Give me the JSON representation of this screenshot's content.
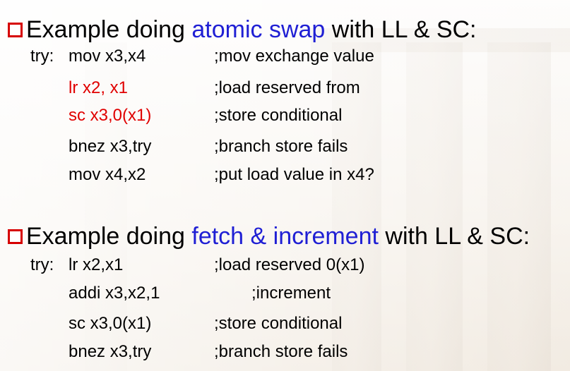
{
  "section1": {
    "heading_pre": "Example doing ",
    "heading_highlight": "atomic swap",
    "heading_post": " with LL & SC:",
    "label": "try:",
    "lines": [
      {
        "instr": "mov x3,x4",
        "comment": ";mov exchange value"
      },
      {
        "instr": "lr x2, x1",
        "comment": ";load reserved from"
      },
      {
        "instr": "sc x3,0(x1)",
        "comment": ";store conditional"
      },
      {
        "instr": "bnez x3,try",
        "comment": ";branch store fails"
      },
      {
        "instr": "mov x4,x2",
        "comment": ";put load value in x4?"
      }
    ]
  },
  "section2": {
    "heading_pre": "Example doing ",
    "heading_highlight": "fetch & increment",
    "heading_post": " with LL & SC:",
    "label": "try:",
    "lines": [
      {
        "instr": "lr x2,x1",
        "comment": ";load reserved 0(x1)"
      },
      {
        "instr": "addi x3,x2,1",
        "comment": ";increment"
      },
      {
        "instr": "sc x3,0(x1)",
        "comment": ";store conditional"
      },
      {
        "instr": "bnez x3,try",
        "comment": ";branch store fails"
      }
    ]
  },
  "colors": {
    "highlight": "#1f1fd4",
    "emphasis": "#e00000",
    "bullet": "#d60000"
  }
}
